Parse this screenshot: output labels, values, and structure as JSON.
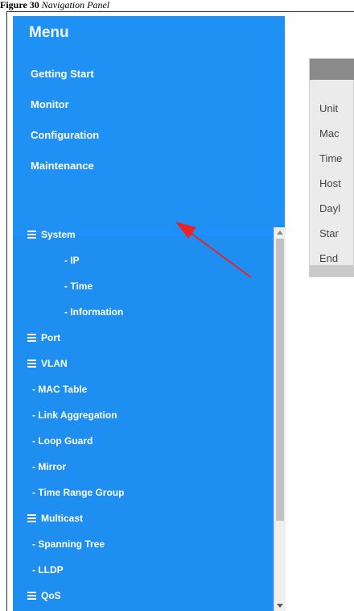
{
  "caption": {
    "prefix": "Figure 30",
    "text": "Navigation Panel"
  },
  "menu": {
    "title": "Menu",
    "links": [
      "Getting Start",
      "Monitor",
      "Configuration",
      "Maintenance"
    ]
  },
  "tree": [
    {
      "label": "System",
      "type": "group"
    },
    {
      "label": "- IP",
      "type": "sub"
    },
    {
      "label": "- Time",
      "type": "sub"
    },
    {
      "label": "- Information",
      "type": "sub"
    },
    {
      "label": "Port",
      "type": "group"
    },
    {
      "label": "VLAN",
      "type": "group"
    },
    {
      "label": "- MAC Table",
      "type": "item"
    },
    {
      "label": "- Link Aggregation",
      "type": "item"
    },
    {
      "label": "- Loop Guard",
      "type": "item"
    },
    {
      "label": "- Mirror",
      "type": "item"
    },
    {
      "label": "- Time Range Group",
      "type": "item"
    },
    {
      "label": "Multicast",
      "type": "group"
    },
    {
      "label": "- Spanning Tree",
      "type": "item"
    },
    {
      "label": "- LLDP",
      "type": "item"
    },
    {
      "label": "QoS",
      "type": "group"
    }
  ],
  "right_panel": {
    "rows": [
      "Unit",
      "Mac",
      "Time",
      "Host",
      "Dayl",
      "Star",
      "End"
    ]
  },
  "colors": {
    "sidebar": "#1e90ff",
    "annotation_arrow": "#e8232a"
  }
}
